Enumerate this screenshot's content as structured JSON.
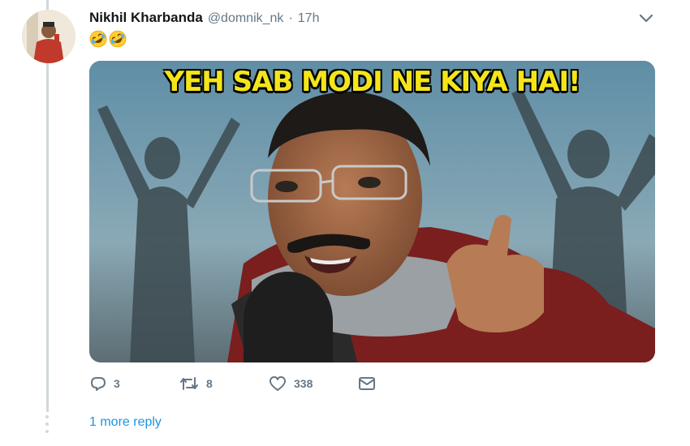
{
  "tweet": {
    "display_name": "Nikhil Kharbanda",
    "handle": "@domnik_nk",
    "separator": "·",
    "time": "17h",
    "emojis": [
      "rolling-on-floor-laughing-emoji",
      "rolling-on-floor-laughing-emoji"
    ],
    "media": {
      "caption": "YEH SAB MODI NE KIYA HAI!"
    },
    "actions": {
      "reply_count": "3",
      "retweet_count": "8",
      "like_count": "338"
    }
  },
  "thread": {
    "more_replies_label": "1 more reply"
  },
  "colors": {
    "link": "#1b95e0",
    "muted": "#657786",
    "caption": "#f4e51a",
    "thread_line": "#cfd9de"
  }
}
